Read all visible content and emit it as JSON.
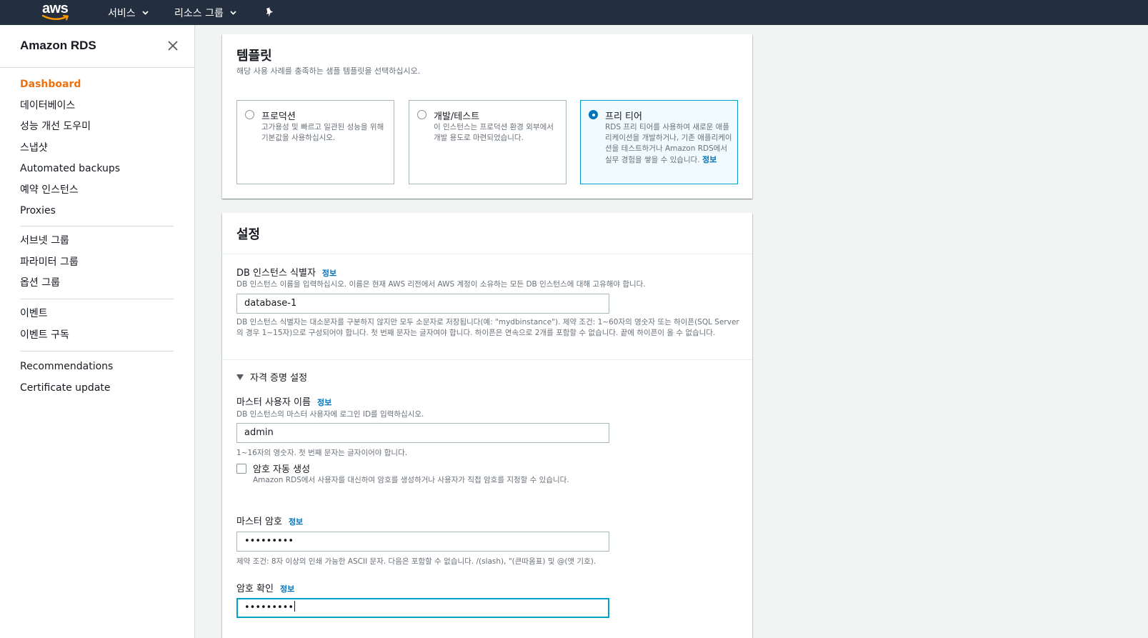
{
  "topnav": {
    "logo_text": "aws",
    "services_label": "서비스",
    "resource_groups_label": "리소스 그룹",
    "pin_icon": "pushpin-icon"
  },
  "sidebar": {
    "title": "Amazon RDS",
    "close_icon": "close-icon",
    "groups": [
      [
        "Dashboard",
        "데이터베이스",
        "성능 개선 도우미",
        "스냅샷",
        "Automated backups",
        "예약 인스턴스",
        "Proxies"
      ],
      [
        "서브넷 그룹",
        "파라미터 그룹",
        "옵션 그룹"
      ],
      [
        "이벤트",
        "이벤트 구독"
      ],
      [
        "Recommendations",
        "Certificate update"
      ]
    ],
    "active_item": "Dashboard"
  },
  "templates": {
    "heading": "템플릿",
    "description": "해당 사용 사례를 충족하는 샘플 템플릿을 선택하십시오.",
    "options": [
      {
        "title": "프로덕션",
        "description": "고가용성 및 빠르고 일관된 성능을 위해 기본값을 사용하십시오.",
        "selected": false
      },
      {
        "title": "개발/테스트",
        "description": "이 인스턴스는 프로덕션 환경 외부에서 개발 용도로 마련되었습니다.",
        "selected": false
      },
      {
        "title": "프리 티어",
        "description": "RDS 프리 티어를 사용하여 새로운 애플리케이션을 개발하거나, 기존 애플리케이션을 테스트하거나 Amazon RDS에서 실무 경험을 쌓을 수 있습니다.",
        "info_link": "정보",
        "selected": true
      }
    ]
  },
  "settings": {
    "heading": "설정",
    "db_identifier": {
      "label": "DB 인스턴스 식별자",
      "info_link": "정보",
      "description": "DB 인스턴스 이름을 입력하십시오. 이름은 현재 AWS 리전에서 AWS 계정이 소유하는 모든 DB 인스턴스에 대해 고유해야 합니다.",
      "value": "database-1",
      "constraint": "DB 인스턴스 식별자는 대소문자를 구분하지 않지만 모두 소문자로 저장됩니다(예: \"mydbinstance\"). 제약 조건: 1~60자의 영숫자 또는 하이픈(SQL Server의 경우 1~15자)으로 구성되어야 합니다. 첫 번째 문자는 글자여야 합니다. 하이픈은 연속으로 2개를 포함할 수 없습니다. 끝에 하이픈이 올 수 없습니다."
    },
    "credentials": {
      "expander_label": "자격 증명 설정",
      "master_username": {
        "label": "마스터 사용자 이름",
        "info_link": "정보",
        "description": "DB 인스턴스의 마스터 사용자에 로그인 ID를 입력하십시오.",
        "value": "admin",
        "constraint": "1~16자의 영숫자. 첫 번째 문자는 글자이어야 합니다."
      },
      "auto_password": {
        "label": "암호 자동 생성",
        "description": "Amazon RDS에서 사용자를 대신하여 암호를 생성하거나 사용자가 직접 암호를 지정할 수 있습니다.",
        "checked": false
      },
      "master_password": {
        "label": "마스터 암호",
        "info_link": "정보",
        "value": "•••••••••",
        "constraint": "제약 조건: 8자 이상의 인쇄 가능한 ASCII 문자. 다음은 포함할 수 없습니다. /(slash), \"(큰따옴표) 및 @(앳 기호)."
      },
      "confirm_password": {
        "label": "암호 확인",
        "info_link": "정보",
        "value": "•••••••••"
      }
    }
  },
  "colors": {
    "topbar": "#232f3e",
    "active_nav": "#ec7211",
    "link": "#0073bb",
    "focus": "#00a1c9"
  }
}
